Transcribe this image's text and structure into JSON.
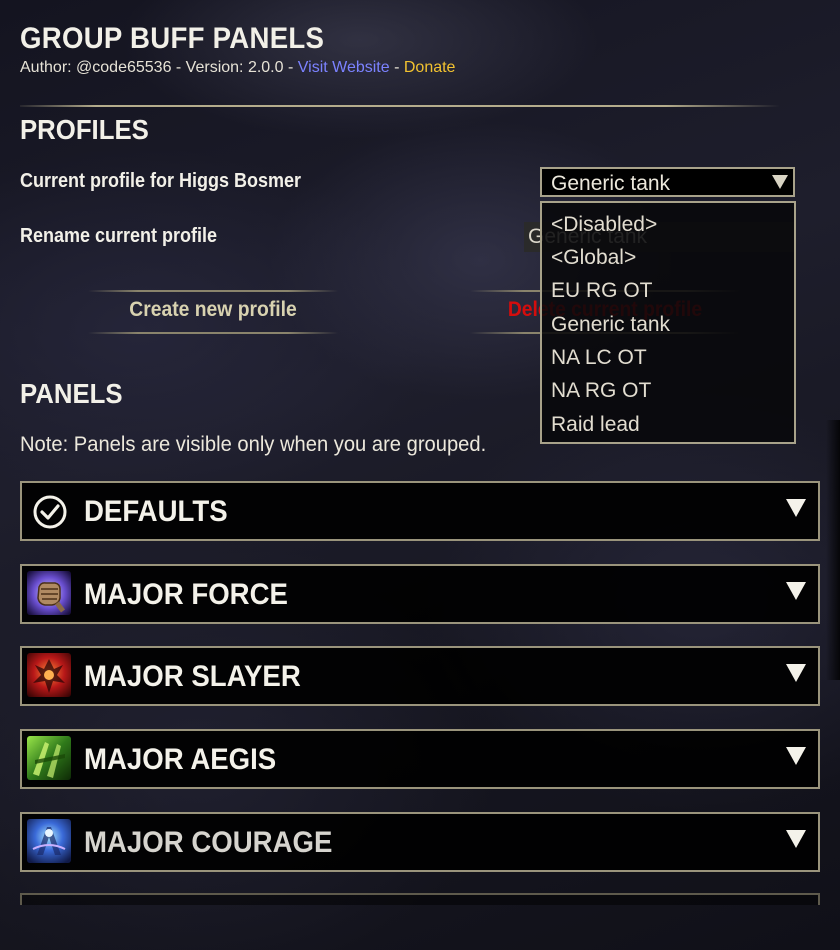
{
  "header": {
    "title": "GROUP BUFF PANELS",
    "author_prefix": "Author: @code65536 - Version: 2.0.0 - ",
    "website_label": "Visit Website",
    "separator": " - ",
    "donate_label": "Donate"
  },
  "profiles": {
    "heading": "PROFILES",
    "current_label": "Current profile for Higgs Bosmer",
    "current_value": "Generic tank",
    "rename_label": "Rename current profile",
    "rename_value": "Generic tank",
    "create_button": "Create new profile",
    "delete_button": "Delete current profile",
    "options": [
      "<Disabled>",
      "<Global>",
      "EU RG OT",
      "Generic tank",
      "NA LC OT",
      "NA RG OT",
      "Raid lead"
    ]
  },
  "panels": {
    "heading": "PANELS",
    "note": "Note: Panels are visible only when you are grouped.",
    "items": [
      {
        "title": "DEFAULTS",
        "icon": "check-circle-icon"
      },
      {
        "title": "MAJOR FORCE",
        "icon": "fist-icon"
      },
      {
        "title": "MAJOR SLAYER",
        "icon": "slayer-icon"
      },
      {
        "title": "MAJOR AEGIS",
        "icon": "aegis-icon"
      },
      {
        "title": "MAJOR COURAGE",
        "icon": "courage-icon"
      }
    ]
  },
  "colors": {
    "website_link": "#7b82ff",
    "donate_link": "#f2c230",
    "delete_button": "#d40d0d",
    "accent_border": "#a8a28a"
  }
}
